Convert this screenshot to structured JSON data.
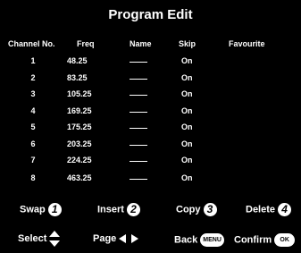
{
  "title": "Program Edit",
  "headers": {
    "channel": "Channel No.",
    "freq": "Freq",
    "name": "Name",
    "skip": "Skip",
    "favourite": "Favourite"
  },
  "rows": [
    {
      "channel": "1",
      "freq": "48.25",
      "skip": "On"
    },
    {
      "channel": "2",
      "freq": "83.25",
      "skip": "On"
    },
    {
      "channel": "3",
      "freq": "105.25",
      "skip": "On"
    },
    {
      "channel": "4",
      "freq": "169.25",
      "skip": "On"
    },
    {
      "channel": "5",
      "freq": "175.25",
      "skip": "On"
    },
    {
      "channel": "6",
      "freq": "203.25",
      "skip": "On"
    },
    {
      "channel": "7",
      "freq": "224.25",
      "skip": "On"
    },
    {
      "channel": "8",
      "freq": "463.25",
      "skip": "On"
    }
  ],
  "footer": {
    "swap_label": "Swap",
    "swap_key": "1",
    "insert_label": "Insert",
    "insert_key": "2",
    "copy_label": "Copy",
    "copy_key": "3",
    "delete_label": "Delete",
    "delete_key": "4",
    "select_label": "Select",
    "page_label": "Page",
    "back_label": "Back",
    "back_key": "MENU",
    "confirm_label": "Confirm",
    "confirm_key": "OK"
  }
}
